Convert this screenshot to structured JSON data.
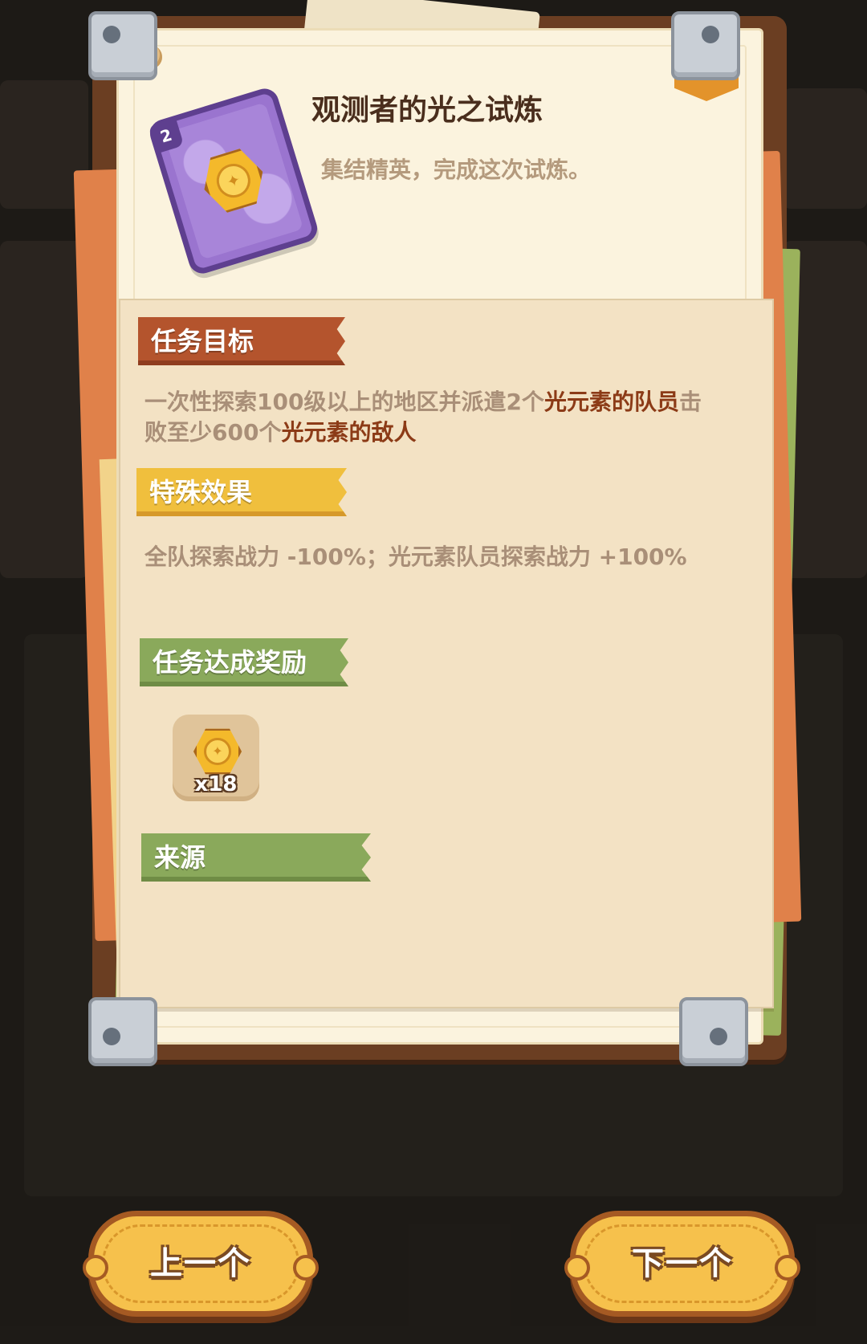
{
  "quest": {
    "title": "观测者的光之试炼",
    "subtitle": "集结精英，完成这次试炼。",
    "card_level": "2",
    "card_icon": "purple-card-coin-icon",
    "badge_icon": "star-icon"
  },
  "sections": {
    "goal": {
      "heading": "任务目标",
      "text_parts": [
        "一次性探索100级以上的地区并派遣2个",
        "光元素的队员",
        "击败至少600个",
        "光元素的敌人"
      ]
    },
    "effect": {
      "heading": "特殊效果",
      "text": "全队探索战力 -100%；光元素队员探索战力 +100%"
    },
    "reward": {
      "heading": "任务达成奖励",
      "items": [
        {
          "icon": "gold-coin-icon",
          "quantity": "x18"
        }
      ]
    },
    "source": {
      "heading": "来源"
    }
  },
  "nav": {
    "prev_label": "上一个",
    "next_label": "下一个"
  },
  "colors": {
    "goal_ribbon": "#b4542d",
    "effect_ribbon": "#f0bf3d",
    "reward_ribbon": "#8aa95b",
    "highlight_text": "#8c3b17",
    "button": "#f6c14c"
  }
}
